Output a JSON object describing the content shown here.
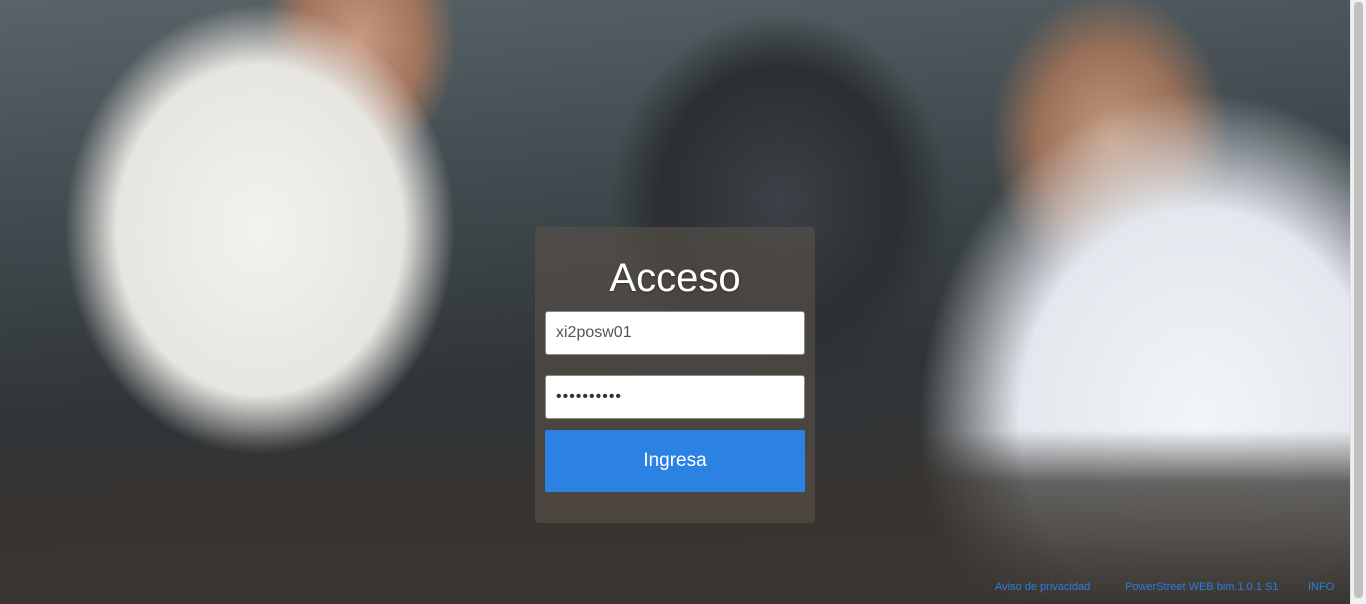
{
  "login": {
    "title": "Acceso",
    "username_value": "xi2posw01",
    "password_value": "••••••••••",
    "submit_label": "Ingresa"
  },
  "footer": {
    "privacy_link": "Aviso de privacidad",
    "version_link": "PowerStreet WEB bim.1.0.1 S1",
    "info_link": "INFO"
  },
  "colors": {
    "primary_button": "#2b82e3",
    "link": "#2b7de0"
  }
}
